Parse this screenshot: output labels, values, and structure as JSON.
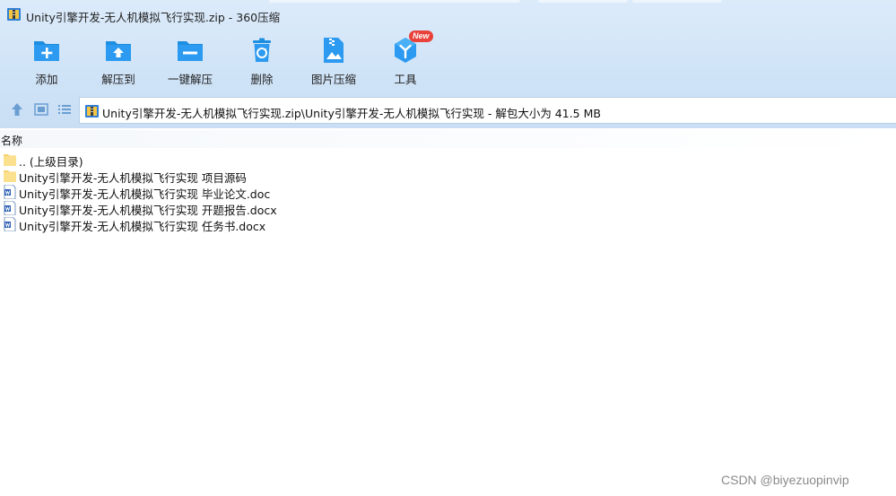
{
  "window": {
    "title": "Unity引擎开发-无人机模拟飞行实现.zip - 360压缩"
  },
  "toolbar": {
    "items": [
      {
        "label": "添加",
        "icon": "add-folder-icon"
      },
      {
        "label": "解压到",
        "icon": "extract-to-icon"
      },
      {
        "label": "一键解压",
        "icon": "one-click-extract-icon"
      },
      {
        "label": "删除",
        "icon": "recycle-bin-icon"
      },
      {
        "label": "图片压缩",
        "icon": "image-compress-icon"
      },
      {
        "label": "工具",
        "icon": "tools-icon",
        "badge": "New"
      }
    ]
  },
  "address": {
    "path": "Unity引擎开发-无人机模拟飞行实现.zip\\Unity引擎开发-无人机模拟飞行实现 - 解包大小为 41.5 MB"
  },
  "list": {
    "column_name": "名称",
    "rows": [
      {
        "name": ".. (上级目录)",
        "type": "folder"
      },
      {
        "name": "Unity引擎开发-无人机模拟飞行实现 项目源码",
        "type": "folder"
      },
      {
        "name": "Unity引擎开发-无人机模拟飞行实现 毕业论文.doc",
        "type": "doc"
      },
      {
        "name": "Unity引擎开发-无人机模拟飞行实现 开题报告.docx",
        "type": "docx"
      },
      {
        "name": "Unity引擎开发-无人机模拟飞行实现 任务书.docx",
        "type": "docx"
      }
    ]
  },
  "watermark": "CSDN @biyezuopinvip",
  "colors": {
    "accent": "#1e8ee0",
    "folder": "#f7d36d",
    "badge": "#e8423a"
  }
}
